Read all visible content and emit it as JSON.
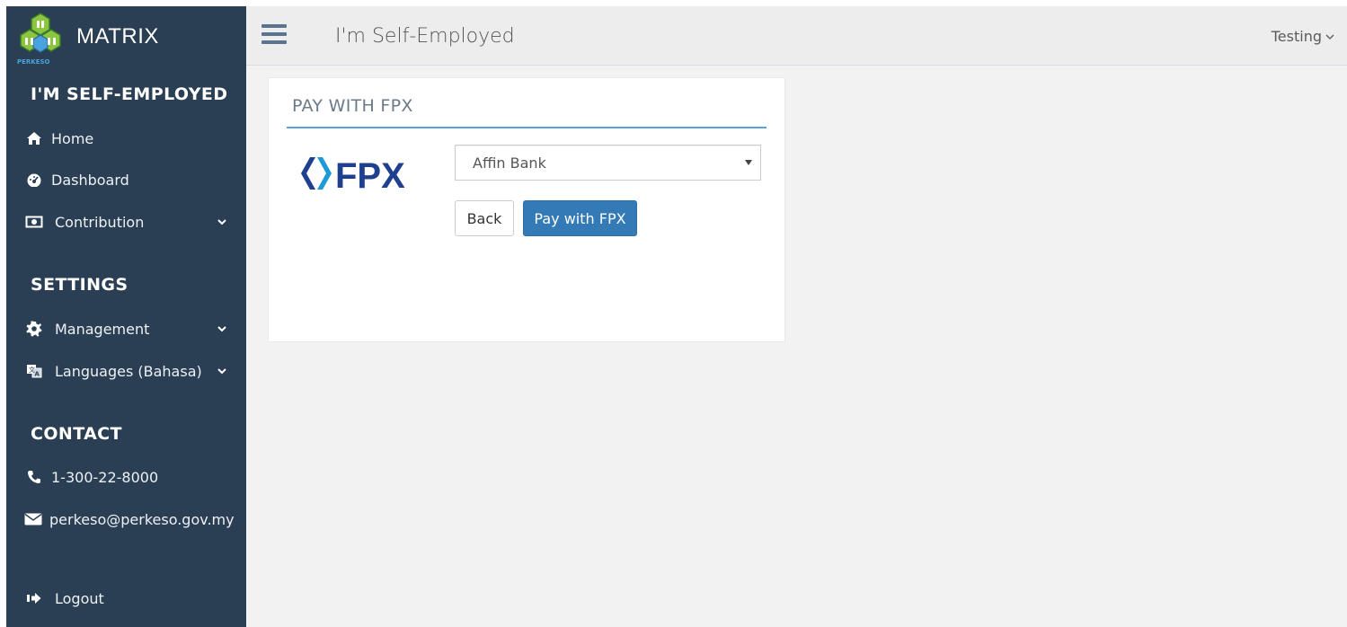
{
  "brand": {
    "title": "MATRIX",
    "logo_caption": "PERKESO"
  },
  "sections": {
    "main": "I'M SELF-EMPLOYED",
    "settings": "SETTINGS",
    "contact": "CONTACT"
  },
  "nav": {
    "home": "Home",
    "dashboard": "Dashboard",
    "contribution": "Contribution",
    "management": "Management",
    "languages": "Languages (Bahasa)",
    "phone": "1-300-22-8000",
    "email": "perkeso@perkeso.gov.my",
    "logout": "Logout"
  },
  "header": {
    "title": "I'm Self-Employed",
    "user": "Testing"
  },
  "panel": {
    "title": "PAY WITH FPX",
    "logo_text": "FPX",
    "bank_select": {
      "selected": "Affin Bank"
    },
    "back_label": "Back",
    "pay_label": "Pay with FPX"
  },
  "colors": {
    "sidebar": "#2a3f54",
    "primary_button": "#337ab7",
    "panel_rule": "#5aa0d8",
    "fpx_blue": "#1f3f8f",
    "fpx_cyan": "#1e9ad6"
  },
  "icons": [
    "menu-icon",
    "home-icon",
    "dashboard-icon",
    "money-icon",
    "gear-icon",
    "language-icon",
    "phone-icon",
    "envelope-icon",
    "logout-icon",
    "chevron-down-icon"
  ]
}
